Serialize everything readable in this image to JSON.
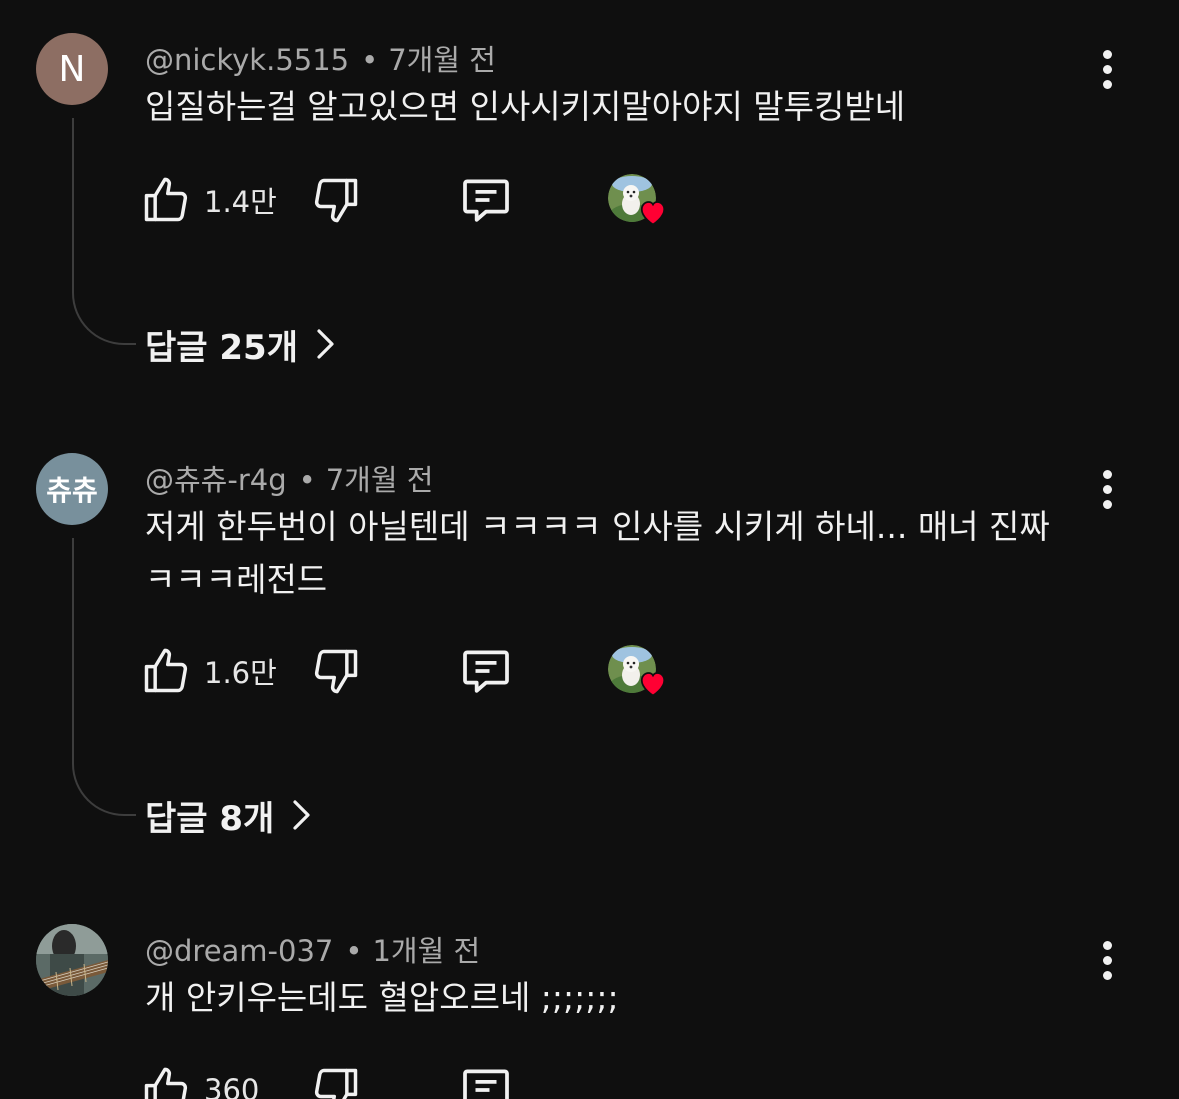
{
  "comments": [
    {
      "avatar_text": "N",
      "avatar_color": "#8d6e63",
      "handle": "@nickyk.5515",
      "time": "7개월 전",
      "text": "입질하는걸 알고있으면 인사시키지말아야지 말투킹받네",
      "likes": "1.4만",
      "creator_hearted": true,
      "replies_label": "답글 25개"
    },
    {
      "avatar_text": "츄츄",
      "avatar_color": "#78909c",
      "handle": "@츄츄-r4g",
      "time": "7개월 전",
      "text": "저게 한두번이 아닐텐데 ㅋㅋㅋㅋ 인사를 시키게 하네... 매너 진짜 ㅋㅋㅋ레전드",
      "likes": "1.6만",
      "creator_hearted": true,
      "replies_label": "답글 8개"
    },
    {
      "avatar_text": "",
      "avatar_color": "#4a5a55",
      "handle": "@dream-037",
      "time": "1개월 전",
      "text": "개 안키우는데도 혈압오르네 ;;;;;;;",
      "likes": "360",
      "creator_hearted": false,
      "replies_label": ""
    }
  ],
  "meta_separator": "•",
  "icons": {
    "like": "thumbs-up-icon",
    "dislike": "thumbs-down-icon",
    "reply": "comment-icon",
    "more": "more-vertical-icon",
    "heart": "heart-icon",
    "chevron": "chevron-right-icon"
  },
  "colors": {
    "background": "#0f0f0f",
    "heart": "#ff0033",
    "secondary_text": "#aaaaaa"
  }
}
